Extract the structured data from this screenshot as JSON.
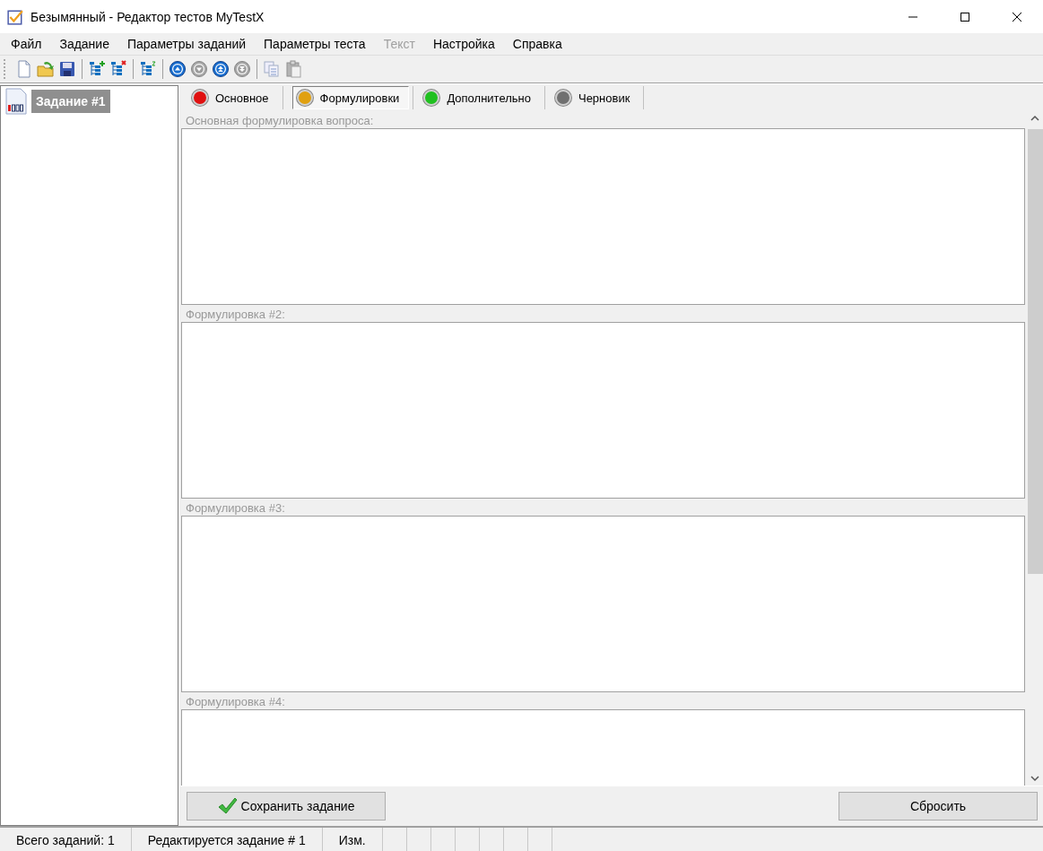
{
  "window": {
    "title": "Безымянный - Редактор тестов MyTestX"
  },
  "menu": [
    {
      "label": "Файл",
      "disabled": false
    },
    {
      "label": "Задание",
      "disabled": false
    },
    {
      "label": "Параметры заданий",
      "disabled": false
    },
    {
      "label": "Параметры теста",
      "disabled": false
    },
    {
      "label": "Текст",
      "disabled": true
    },
    {
      "label": "Настройка",
      "disabled": false
    },
    {
      "label": "Справка",
      "disabled": false
    }
  ],
  "toolbar": [
    {
      "kind": "new",
      "disabled": false
    },
    {
      "kind": "open",
      "disabled": false
    },
    {
      "kind": "save",
      "disabled": false
    },
    {
      "kind": "sep"
    },
    {
      "kind": "add",
      "disabled": false
    },
    {
      "kind": "remove",
      "disabled": false
    },
    {
      "kind": "sep"
    },
    {
      "kind": "number",
      "disabled": false
    },
    {
      "kind": "sep"
    },
    {
      "kind": "up",
      "disabled": false
    },
    {
      "kind": "down",
      "disabled": true
    },
    {
      "kind": "top",
      "disabled": false
    },
    {
      "kind": "bottom",
      "disabled": true
    },
    {
      "kind": "sep"
    },
    {
      "kind": "copy",
      "disabled": true
    },
    {
      "kind": "paste",
      "disabled": true
    }
  ],
  "tree": [
    {
      "label": "Задание #1",
      "selected": true
    }
  ],
  "tabs": [
    {
      "label": "Основное",
      "selected": false,
      "color": "#e01010"
    },
    {
      "label": "Формулировки",
      "selected": true,
      "color": "#e0a010"
    },
    {
      "label": "Дополнительно",
      "selected": false,
      "color": "#20c020"
    },
    {
      "label": "Черновик",
      "selected": false,
      "color": "#707070"
    }
  ],
  "fields": [
    {
      "label": "Основная формулировка вопроса:"
    },
    {
      "label": "Формулировка #2:"
    },
    {
      "label": "Формулировка #3:"
    },
    {
      "label": "Формулировка #4:"
    }
  ],
  "buttons": [
    {
      "kind": "save",
      "label": "Сохранить задание"
    },
    {
      "kind": "reset",
      "label": "Сбросить"
    }
  ],
  "status_bar": [
    {
      "text": "Всего заданий: 1"
    },
    {
      "text": "Редактируется задание # 1"
    },
    {
      "text": "Изм."
    }
  ]
}
